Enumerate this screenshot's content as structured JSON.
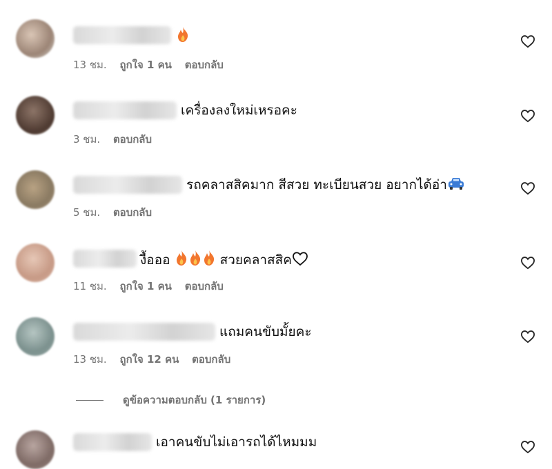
{
  "comments": [
    {
      "text": "",
      "emoji_after": [
        "fire"
      ],
      "time": "13 ชม.",
      "likes": "ถูกใจ 1 คน",
      "reply": "ตอบกลับ",
      "avatar_color": "#b9a394"
    },
    {
      "text": "เครื่องลงใหม่เหรอคะ",
      "emoji_after": [],
      "time": "3 ชม.",
      "likes": "",
      "reply": "ตอบกลับ",
      "avatar_color": "#6b5449"
    },
    {
      "text": "รถคลาสสิคมาก สีสวย ทะเบียนสวย อยากได้อ่า",
      "emoji_after": [
        "car"
      ],
      "time": "5 ชม.",
      "likes": "",
      "reply": "ตอบกลับ",
      "avatar_color": "#a9957c"
    },
    {
      "text": "งื้อออ",
      "emoji_after": [
        "fire",
        "fire",
        "fire"
      ],
      "text2": "สวยคลาสสิค",
      "time": "11 ชม.",
      "likes": "ถูกใจ 1 คน",
      "reply": "ตอบกลับ",
      "avatar_color": "#d8b3a1"
    },
    {
      "text": "แถมคนขับมั้ยคะ",
      "emoji_after": [],
      "time": "13 ชม.",
      "likes": "ถูกใจ 12 คน",
      "reply": "ตอบกลับ",
      "avatar_color": "#8fa3a0"
    },
    {
      "text": "เอาคนขับไม่เอารถได้ไหมมม",
      "emoji_after": [],
      "time": "",
      "likes": "",
      "reply": "",
      "avatar_color": "#9a8580"
    }
  ],
  "view_replies": "ดูข้อความตอบกลับ (1 รายการ)",
  "colors": {
    "meta": "#737373",
    "text": "#111111",
    "fire": "#f2762e",
    "car": "#3a7bd5"
  }
}
